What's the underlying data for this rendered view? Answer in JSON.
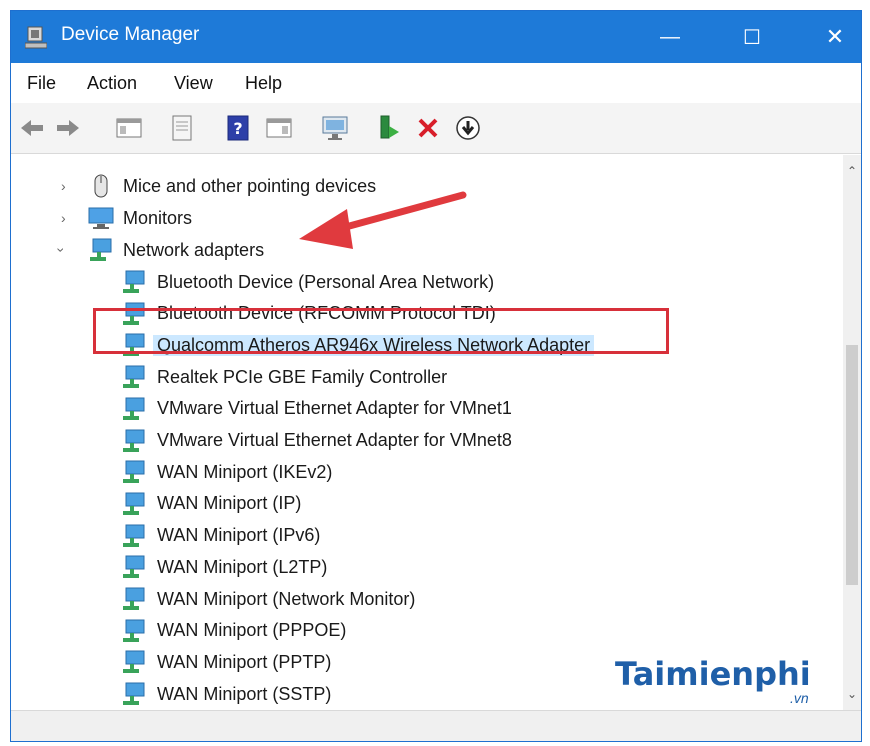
{
  "window": {
    "title": "Device Manager",
    "controls": {
      "minimize": "—",
      "maximize": "☐",
      "close": "✕"
    }
  },
  "menu": [
    "File",
    "Action",
    "View",
    "Help"
  ],
  "toolbar_icons": [
    "back-icon",
    "forward-icon",
    "show-hide-tree-icon",
    "properties-icon",
    "help-icon",
    "action-pane-icon",
    "monitor-icon",
    "update-driver-icon",
    "uninstall-icon",
    "disable-device-icon"
  ],
  "tree": {
    "categories": [
      {
        "label": "Mice and other pointing devices",
        "expanded": false,
        "icon": "mouse-icon"
      },
      {
        "label": "Monitors",
        "expanded": false,
        "icon": "monitor-icon"
      },
      {
        "label": "Network adapters",
        "expanded": true,
        "icon": "network-adapter-icon"
      }
    ],
    "network_adapters": [
      "Bluetooth Device (Personal Area Network)",
      "Bluetooth Device (RFCOMM Protocol TDI)",
      "Qualcomm Atheros AR946x Wireless Network Adapter",
      "Realtek PCIe GBE Family Controller",
      "VMware Virtual Ethernet Adapter for VMnet1",
      "VMware Virtual Ethernet Adapter for VMnet8",
      "WAN Miniport (IKEv2)",
      "WAN Miniport (IP)",
      "WAN Miniport (IPv6)",
      "WAN Miniport (L2TP)",
      "WAN Miniport (Network Monitor)",
      "WAN Miniport (PPPOE)",
      "WAN Miniport (PPTP)",
      "WAN Miniport (SSTP)"
    ],
    "selected_index": 2
  },
  "colors": {
    "titlebar": "#1e7ad8",
    "selection": "#cce8ff",
    "highlight": "#d7303a",
    "arrow": "#e03a3e"
  },
  "watermark": {
    "brand": "Taimienphi",
    "tld": ".vn"
  }
}
